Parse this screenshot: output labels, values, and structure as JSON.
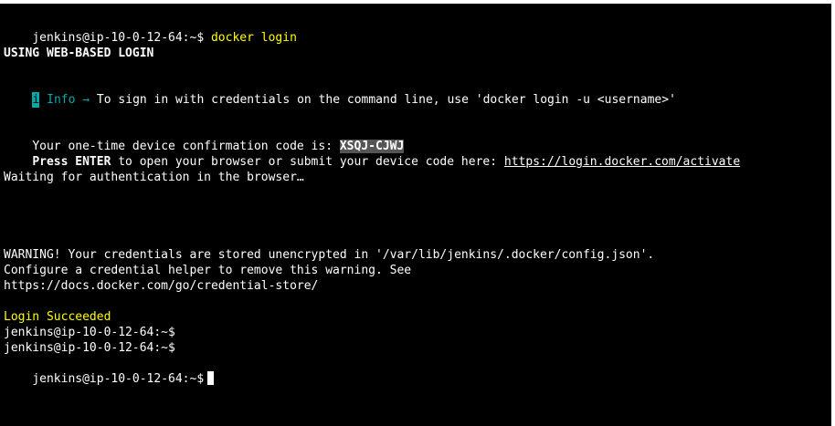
{
  "terminal": {
    "line1_prompt": "jenkins@ip-10-0-12-64:~$ ",
    "line1_command": "docker login",
    "line2": "USING WEB-BASED LOGIN",
    "line3_icon": "i",
    "line3_label": "Info →",
    "line3_text": " To sign in with credentials on the command line, use 'docker login -u <username>'",
    "line4_text": "Your one-time device confirmation code is: ",
    "line4_code": "XSQJ-CJWJ",
    "line5_bold": "Press ENTER",
    "line5_text": " to open your browser or submit your device code here: ",
    "line5_link": "https://login.docker.com/activate",
    "line6": "Waiting for authentication in the browser…",
    "line7": "WARNING! Your credentials are stored unencrypted in '/var/lib/jenkins/.docker/config.json'.",
    "line8": "Configure a credential helper to remove this warning. See",
    "line9": "https://docs.docker.com/go/credential-store/",
    "line10": "Login Succeeded",
    "prompt1": "jenkins@ip-10-0-12-64:~$",
    "prompt2": "jenkins@ip-10-0-12-64:~$",
    "prompt3": "jenkins@ip-10-0-12-64:~$"
  },
  "colors": {
    "background": "#000000",
    "text": "#ffffff",
    "command": "#ffff00",
    "info": "#00aaaa",
    "success": "#ffff00"
  }
}
